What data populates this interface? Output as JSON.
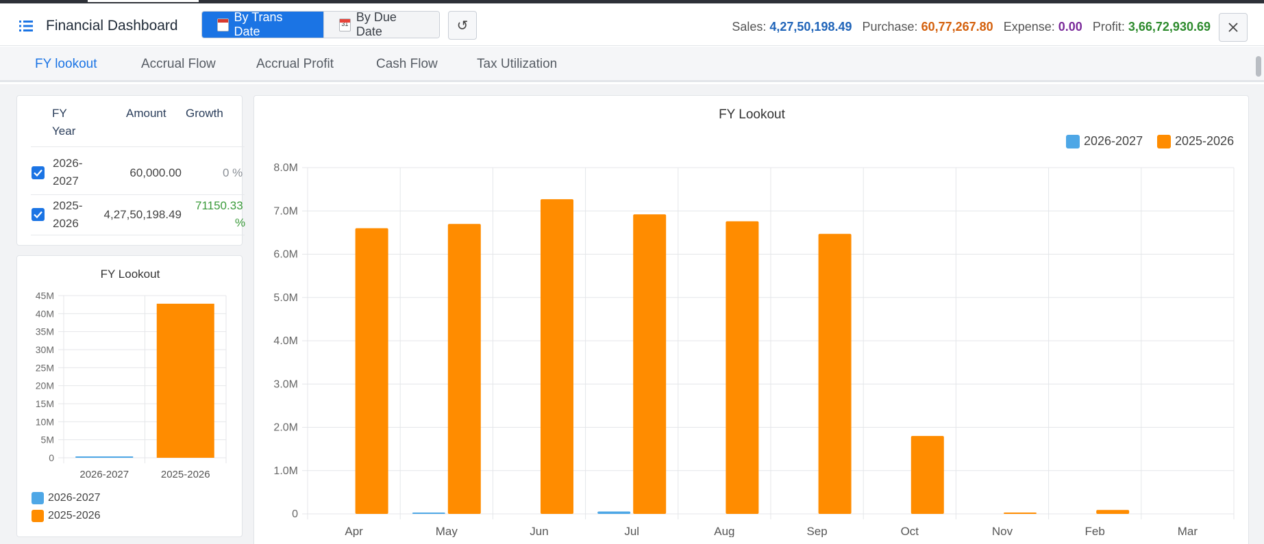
{
  "app": {
    "title": "Financial Dashboard"
  },
  "toggle": {
    "by_trans_date": "By Trans Date",
    "by_due_date": "By Due Date",
    "calendar_day": "31"
  },
  "summary": {
    "sales_label": "Sales:",
    "sales_value": "4,27,50,198.49",
    "purchase_label": "Purchase:",
    "purchase_value": "60,77,267.80",
    "expense_label": "Expense:",
    "expense_value": "0.00",
    "profit_label": "Profit:",
    "profit_value": "3,66,72,930.69"
  },
  "tabs": [
    {
      "label": "FY lookout",
      "active": true
    },
    {
      "label": "Accrual Flow",
      "active": false
    },
    {
      "label": "Accrual Profit",
      "active": false
    },
    {
      "label": "Cash Flow",
      "active": false
    },
    {
      "label": "Tax Utilization",
      "active": false
    }
  ],
  "fy_table": {
    "headers": {
      "fy_year_1": "FY",
      "fy_year_2": "Year",
      "amount": "Amount",
      "growth": "Growth"
    },
    "rows": [
      {
        "year_1": "2026-",
        "year_2": "2027",
        "amount": "60,000.00",
        "growth_1": "0 %",
        "growth_2": "",
        "checked": true
      },
      {
        "year_1": "2025-",
        "year_2": "2026",
        "amount": "4,27,50,198.49",
        "growth_1": "71150.33",
        "growth_2": "%",
        "checked": true
      }
    ]
  },
  "colors": {
    "series_a": "#4ea7e6",
    "series_b": "#ff8c00",
    "accent": "#1b74e4"
  },
  "small_chart": {
    "chart_data": {
      "type": "bar",
      "title": "FY Lookout",
      "categories": [
        "2026-2027",
        "2025-2026"
      ],
      "series": [
        {
          "name": "2026-2027",
          "values": [
            60000,
            null
          ]
        },
        {
          "name": "2025-2026",
          "values": [
            null,
            42750198.49
          ]
        }
      ],
      "ylim": [
        0,
        45000000
      ],
      "yticks": [
        "45M",
        "40M",
        "35M",
        "30M",
        "25M",
        "20M",
        "15M",
        "10M",
        "5M",
        "0"
      ],
      "legend": [
        "2026-2027",
        "2025-2026"
      ],
      "legend_position": "bottom-left",
      "grid": true
    }
  },
  "big_chart": {
    "chart_data": {
      "type": "bar",
      "title": "FY Lookout",
      "categories": [
        "Apr",
        "May",
        "Jun",
        "Jul",
        "Aug",
        "Sep",
        "Oct",
        "Nov",
        "Feb",
        "Mar"
      ],
      "series": [
        {
          "name": "2026-2027",
          "values": [
            0,
            5000,
            0,
            55000,
            0,
            0,
            0,
            0,
            0,
            0
          ]
        },
        {
          "name": "2025-2026",
          "values": [
            6600000,
            6700000,
            7270000,
            6920000,
            6760000,
            6470000,
            1800000,
            25000,
            90000,
            0
          ]
        }
      ],
      "ylim": [
        0,
        8000000
      ],
      "yticks": [
        "8.0M",
        "7.0M",
        "6.0M",
        "5.0M",
        "4.0M",
        "3.0M",
        "2.0M",
        "1.0M",
        "0"
      ],
      "legend": [
        "2026-2027",
        "2025-2026"
      ],
      "legend_position": "top-right",
      "grid": true
    }
  }
}
